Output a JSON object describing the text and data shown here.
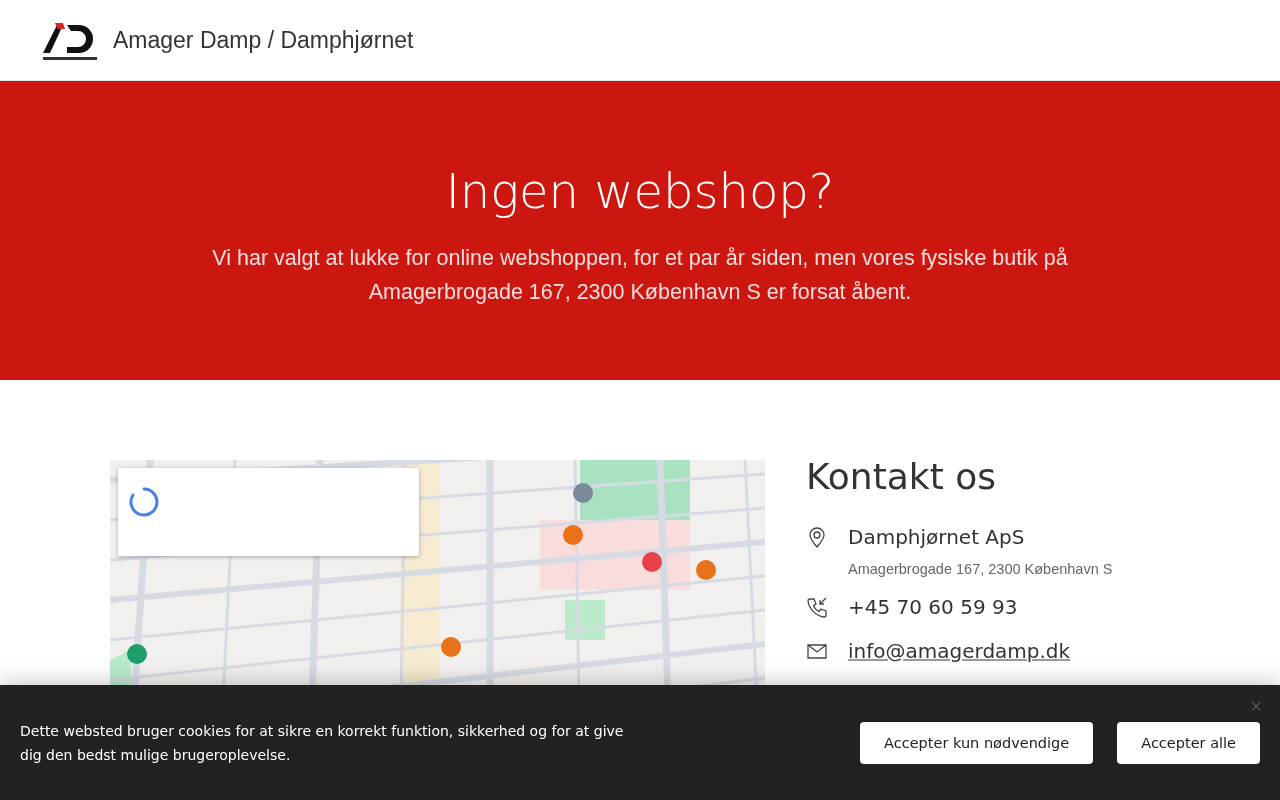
{
  "header": {
    "site_title": "Amager Damp / Damphjørnet"
  },
  "hero": {
    "title": "Ingen webshop?",
    "text": "Vi har valgt at lukke for online webshoppen, for et par år siden, men vores fysiske butik på Amagerbrogade 167, 2300 København S er forsat åbent."
  },
  "map": {
    "loading": true
  },
  "contact": {
    "heading": "Kontakt os",
    "items": [
      {
        "kind": "address",
        "title": "Damphjørnet ApS",
        "detail": "Amagerbrogade 167, 2300 København S"
      },
      {
        "kind": "phone",
        "title": "+45 70 60 59 93"
      },
      {
        "kind": "email",
        "title": "info@amagerdamp.dk"
      }
    ]
  },
  "cookie_bar": {
    "text": "Dette websted bruger cookies for at sikre en korrekt funktion, sikkerhed og for at give dig den bedst mulige brugeroplevelse.",
    "close": "×",
    "buttons": [
      "Accepter kun nødvendige",
      "Accepter alle"
    ]
  }
}
